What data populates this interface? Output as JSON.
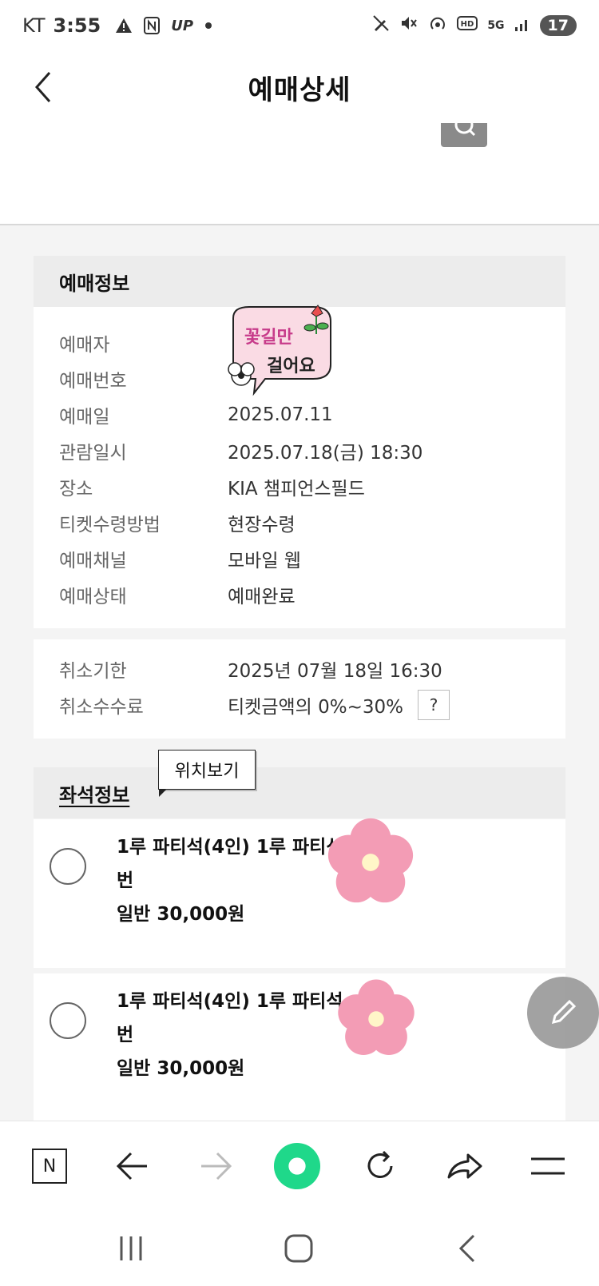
{
  "status_bar": {
    "carrier": "KT",
    "time": "3:55",
    "battery": "17",
    "network": "5G"
  },
  "header": {
    "title": "예매상세"
  },
  "booking_info": {
    "heading": "예매정보",
    "rows": [
      {
        "label": "예매자",
        "value": ""
      },
      {
        "label": "예매번호",
        "value": ""
      },
      {
        "label": "예매일",
        "value": "2025.07.11"
      },
      {
        "label": "관람일시",
        "value": "2025.07.18(금) 18:30"
      },
      {
        "label": "장소",
        "value": "KIA 챔피언스필드"
      },
      {
        "label": "티켓수령방법",
        "value": "현장수령"
      },
      {
        "label": "예매채널",
        "value": "모바일 웹"
      },
      {
        "label": "예매상태",
        "value": "예매완료"
      }
    ]
  },
  "cancel_info": {
    "rows": [
      {
        "label": "취소기한",
        "value": "2025년 07월 18일 16:30"
      },
      {
        "label": "취소수수료",
        "value": "티켓금액의 0%~30%"
      }
    ],
    "help_label": "?"
  },
  "seat_info": {
    "heading": "좌석정보",
    "tooltip": "위치보기",
    "items": [
      {
        "line1": "1루 파티석(4인) 1루 파티석",
        "line2": "번",
        "price": "일반 30,000원"
      },
      {
        "line1": "1루 파티석(4인) 1루 파티석",
        "line2": "번",
        "price": "일반 30,000원"
      }
    ]
  },
  "sticker": {
    "line1": "꽃길만",
    "line2": "걸어요"
  },
  "browser_toolbar": {
    "home_label": "N"
  },
  "colors": {
    "accent_green": "#1fd88a",
    "flower_pink": "#f39cb5",
    "card_head_bg": "#ececec"
  }
}
